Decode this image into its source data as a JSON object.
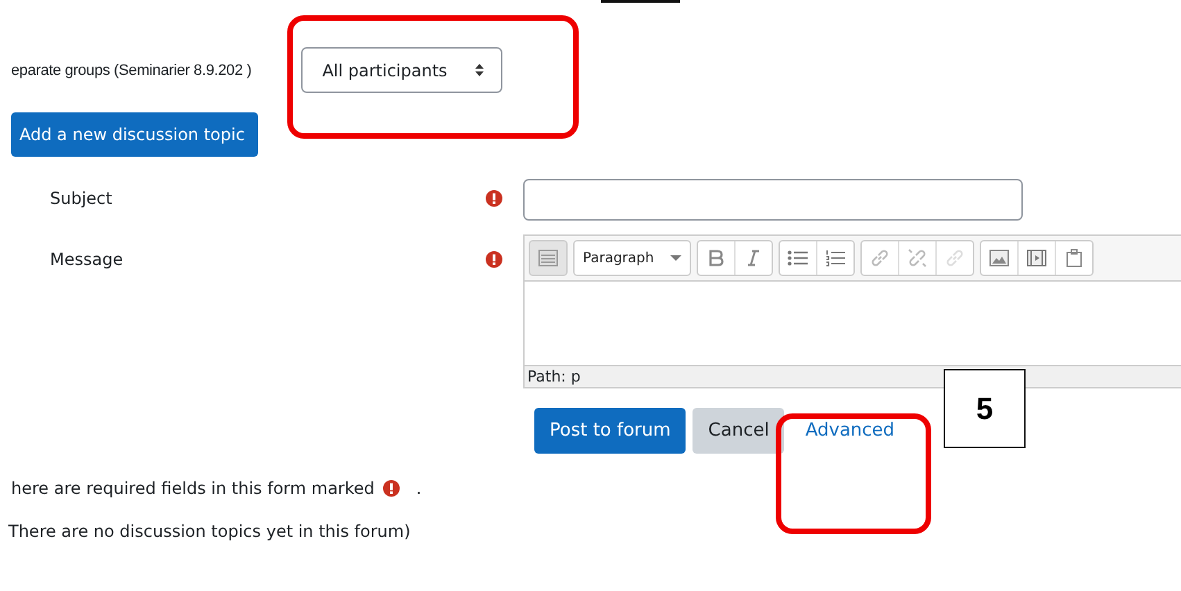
{
  "groups": {
    "label": "eparate groups (Seminarier 8.9.202 )",
    "select_value": "All participants"
  },
  "add_button": "Add a new discussion topic",
  "form": {
    "fields": [
      {
        "kind": "text",
        "label": "Subject",
        "required": true
      },
      {
        "kind": "editor",
        "label": "Message",
        "required": true,
        "style_value": "Paragraph",
        "path": "Path: p"
      }
    ],
    "buttons": [
      {
        "kind": "primary",
        "label": "Post to forum"
      },
      {
        "kind": "secondary",
        "label": "Cancel"
      },
      {
        "kind": "link",
        "label": "Advanced"
      }
    ]
  },
  "required_note": {
    "before": "here are required fields in this form marked",
    "after": "."
  },
  "empty_note": "There are no discussion topics yet in this forum)",
  "callout": {
    "number": "5"
  }
}
